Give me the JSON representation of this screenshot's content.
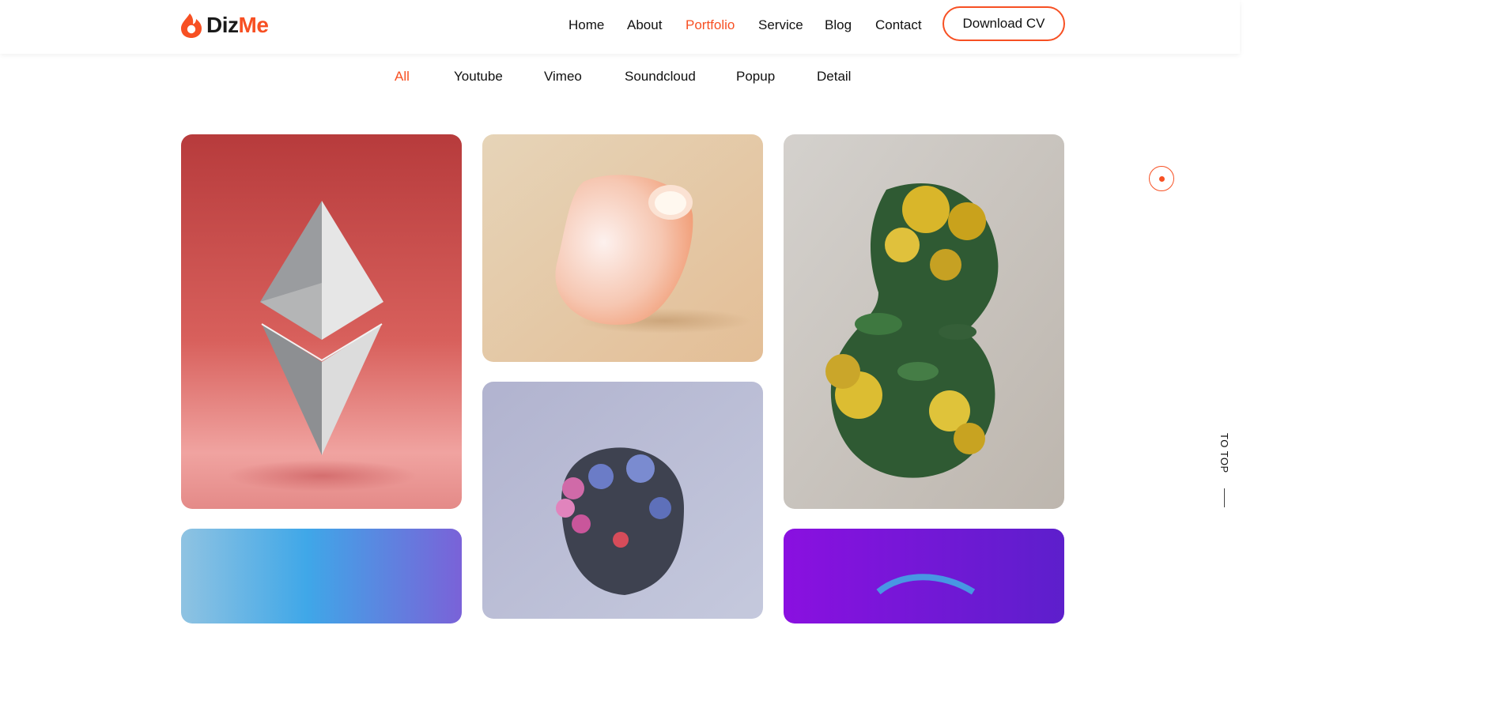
{
  "brand": {
    "name_part1": "Diz",
    "name_part2": "Me",
    "accent": "#f75023",
    "icon": "flame-icon"
  },
  "nav": {
    "items": [
      {
        "label": "Home",
        "active": false
      },
      {
        "label": "About",
        "active": false
      },
      {
        "label": "Portfolio",
        "active": true
      },
      {
        "label": "Service",
        "active": false
      },
      {
        "label": "Blog",
        "active": false
      },
      {
        "label": "Contact",
        "active": false
      }
    ],
    "cta_label": "Download CV"
  },
  "portfolio": {
    "filters": [
      {
        "label": "All",
        "active": true
      },
      {
        "label": "Youtube",
        "active": false
      },
      {
        "label": "Vimeo",
        "active": false
      },
      {
        "label": "Soundcloud",
        "active": false
      },
      {
        "label": "Popup",
        "active": false
      },
      {
        "label": "Detail",
        "active": false
      }
    ],
    "items": [
      {
        "subject": "ethereum-diamond",
        "background": "#c7484a"
      },
      {
        "subject": "ceramic-vase",
        "background": "#ecd2ad"
      },
      {
        "subject": "floral-bust",
        "background": "#c9c4bf"
      },
      {
        "subject": "sculpted-head",
        "background": "#b6bbd3"
      },
      {
        "subject": "blue-gradient",
        "background": "#5aa7e0"
      },
      {
        "subject": "purple-abstract",
        "background": "#7a16d8"
      }
    ]
  },
  "side": {
    "to_top_label": "TO TOP"
  }
}
